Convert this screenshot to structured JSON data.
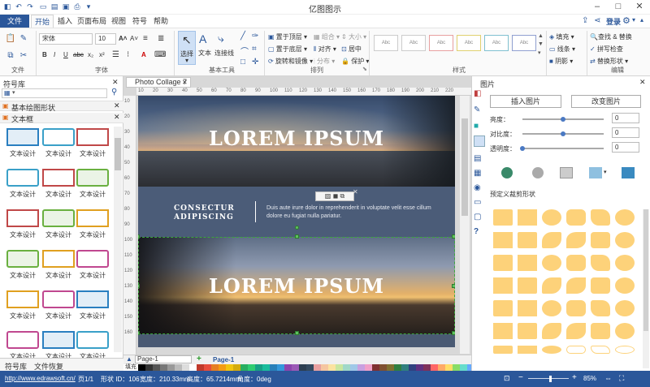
{
  "app": {
    "title": "亿图图示",
    "doc_tab": "Photo Collage 7"
  },
  "menu": {
    "file": "文件",
    "tabs": [
      "开始",
      "插入",
      "页面布局",
      "视图",
      "符号",
      "帮助"
    ],
    "login": "登录"
  },
  "ribbon": {
    "font_name": "宋体",
    "font_size": "10",
    "group_file": "文件",
    "group_font": "字体",
    "group_basic": "基本工具",
    "group_arrange": "排列",
    "group_style": "样式",
    "group_edit": "编辑",
    "select": "选择",
    "text": "文本",
    "connector": "连接线",
    "bring_front": "置于顶层",
    "send_back": "置于底层",
    "rotate_mirror": "旋转和镜像",
    "group": "组合",
    "align": "对齐",
    "distribute": "分布",
    "size": "大小",
    "center": "居中",
    "protect": "保护",
    "style_label": "Abc",
    "fill": "填充",
    "line": "线条",
    "shadow": "阴影",
    "find_replace": "查找 & 替换",
    "spell_check": "拼写检查",
    "change_shape": "替换形状"
  },
  "left_panel": {
    "title": "符号库",
    "basic_shapes": "基本绘图形状",
    "text_box": "文本框",
    "item_label": "文本设计",
    "tab_library": "符号库",
    "tab_restore": "文件恢复"
  },
  "canvas": {
    "heading1": "LOREM IPSUM",
    "heading2": "LOREM IPSUM",
    "consectur": "CONSECTUR",
    "adipiscing": "ADIPISCING",
    "body_line1": "Duis aute irure dolor in reprehenderit in voluptate velit esse cillum",
    "body_line2": "dolore eu fugiat nulla pariatur.",
    "ruler_h": [
      "10",
      "20",
      "30",
      "40",
      "50",
      "60",
      "70",
      "80",
      "90",
      "100",
      "110",
      "120",
      "130",
      "140",
      "150",
      "160",
      "170",
      "180",
      "190",
      "200",
      "210",
      "220"
    ],
    "ruler_v": [
      "10",
      "20",
      "30",
      "40",
      "50",
      "60",
      "70",
      "80",
      "90",
      "100",
      "110",
      "120",
      "130",
      "140",
      "150",
      "160"
    ]
  },
  "pagebar": {
    "page_select": "Page-1",
    "page_tab": "Page-1",
    "fill_label": "填充"
  },
  "right_panel": {
    "title": "图片",
    "insert_image": "插入图片",
    "change_image": "改变图片",
    "brightness": "亮度：",
    "contrast": "对比度：",
    "transparency": "透明度：",
    "brightness_val": "0",
    "contrast_val": "0",
    "transparency_val": "0",
    "preset_clip": "预定义裁剪形状"
  },
  "status": {
    "url": "http://www.edrawsoft.cn/",
    "page": "页1/1",
    "shape_id": "形状 ID：106",
    "width": "宽度：210.33mm",
    "height": "高度：65.7214mm",
    "angle": "角度：0deg",
    "zoom": "85%"
  },
  "colors": {
    "accent": "#2b579a",
    "clip": "#fdd27a",
    "page_bg": "#4a5a73"
  }
}
